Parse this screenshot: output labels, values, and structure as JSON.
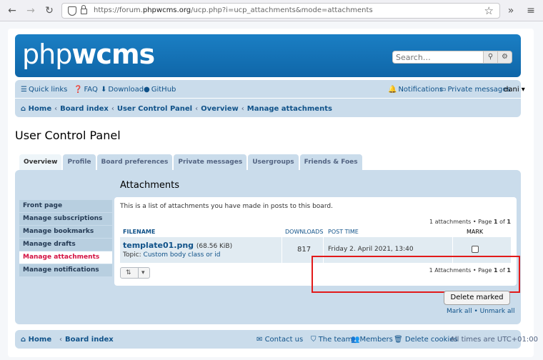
{
  "browser": {
    "url_prefix": "https://forum.",
    "url_host": "phpwcms.org",
    "url_path": "/ucp.php?i=ucp_attachments&mode=attachments"
  },
  "header": {
    "logo_light": "php",
    "logo_bold": "wcms",
    "search_placeholder": "Search…"
  },
  "navbar": {
    "quick_links": "Quick links",
    "faq": "FAQ",
    "download": "Download",
    "github": "GitHub",
    "notifications": "Notifications",
    "private_messages": "Private messages",
    "user": "dani"
  },
  "breadcrumbs": [
    "Home",
    "Board index",
    "User Control Panel",
    "Overview",
    "Manage attachments"
  ],
  "page_title": "User Control Panel",
  "tabs": [
    "Overview",
    "Profile",
    "Board preferences",
    "Private messages",
    "Usergroups",
    "Friends & Foes"
  ],
  "menu": [
    "Front page",
    "Manage subscriptions",
    "Manage bookmarks",
    "Manage drafts",
    "Manage attachments",
    "Manage notifications"
  ],
  "attachments": {
    "title": "Attachments",
    "intro": "This is a list of attachments you have made in posts to this board.",
    "pageinfo_top_count": "1 attachments • Page",
    "page_current": "1",
    "page_of": "of",
    "page_total": "1",
    "pageinfo_bottom_count": "1 Attachments • Page",
    "columns": {
      "filename": "FILENAME",
      "downloads": "DOWNLOADS",
      "post_time": "POST TIME",
      "mark": "MARK"
    },
    "rows": [
      {
        "filename": "template01.png",
        "size": "(68.56 KiB)",
        "topic_label": "Topic:",
        "topic": "Custom body class or id",
        "downloads": "817",
        "post_time": "Friday 2. April 2021, 13:40"
      }
    ],
    "delete_marked": "Delete marked",
    "mark_all": "Mark all",
    "unmark_all": "Unmark all"
  },
  "footer": {
    "home": "Home",
    "board_index": "Board index",
    "contact": "Contact us",
    "team": "The team",
    "members": "Members",
    "delete_cookies": "Delete cookies",
    "timezone": "All times are UTC+01:00"
  }
}
